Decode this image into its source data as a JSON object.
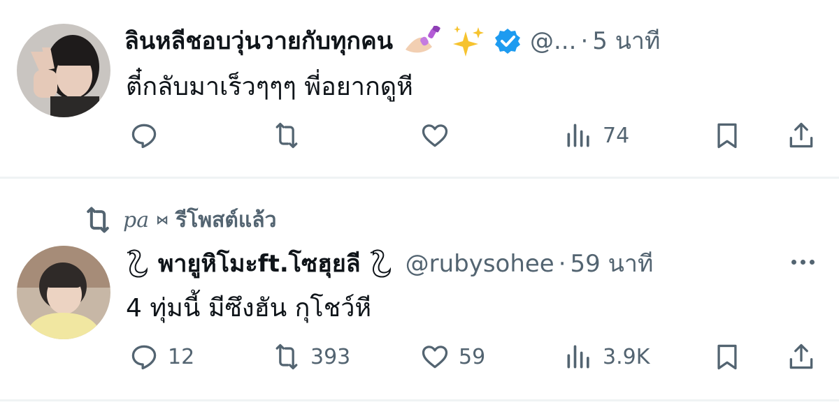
{
  "post1": {
    "display_name": "ลินหลีชอบวุ่นวายกับทุกคน",
    "name_emojis": [
      "nail-polish-emoji",
      "sparkles-emoji"
    ],
    "verified": true,
    "handle": "@...",
    "separator": "·",
    "time": "5 นาที",
    "text": "ตี๋กลับมาเร็วๆๆๆ พี่อยากดูหี",
    "actions": {
      "reply_count": "",
      "repost_count": "",
      "like_count": "",
      "views_count": "74"
    }
  },
  "post2": {
    "repost_by_handle": "pa",
    "repost_by_glyph": "⋈",
    "repost_label": "รีโพสต์แล้ว",
    "display_name": "พายูหิโมะft.โซฮุยลี",
    "name_emojis": [
      "swan-icon",
      "swan-icon"
    ],
    "handle": "@rubysohee",
    "separator": "·",
    "time": "59 นาที",
    "text": "4 ทุ่มนี้ มีซึงฮัน กุโชว์หี",
    "actions": {
      "reply_count": "12",
      "repost_count": "393",
      "like_count": "59",
      "views_count": "3.9K"
    }
  },
  "colors": {
    "text_primary": "#0f1419",
    "text_secondary": "#536471",
    "verified_blue": "#1d9bf0",
    "divider": "#eff3f4"
  }
}
